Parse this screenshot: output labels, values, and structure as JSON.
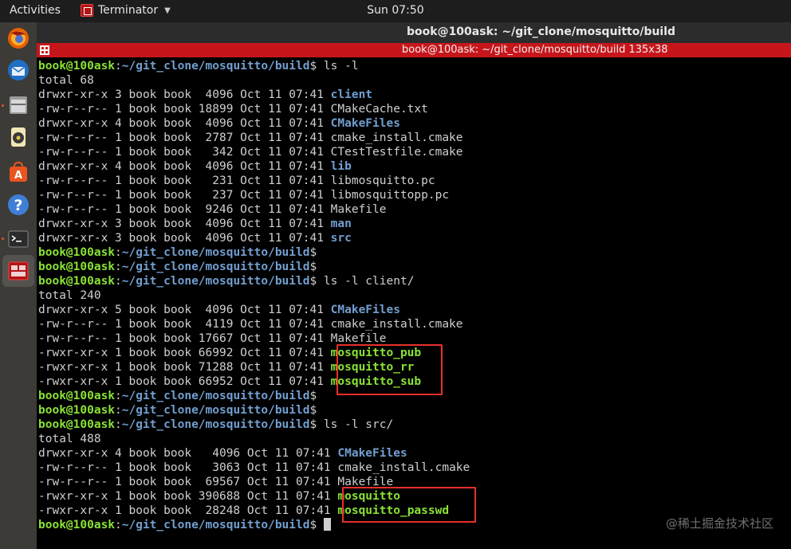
{
  "topbar": {
    "activities": "Activities",
    "app_name": "Terminator",
    "clock": "Sun 07:50"
  },
  "dock": {
    "items": [
      "firefox-icon",
      "thunderbird-icon",
      "files-icon",
      "rhythmbox-icon",
      "software-center-icon",
      "help-icon",
      "terminal-icon",
      "terminator-icon"
    ]
  },
  "window": {
    "title": "book@100ask: ~/git_clone/mosquitto/build",
    "tab_title": "book@100ask: ~/git_clone/mosquitto/build 135x38"
  },
  "terminal": {
    "prompt_user": "book@100ask",
    "prompt_path": "~/git_clone/mosquitto/build",
    "lines": [
      {
        "kind": "prompt",
        "cmd": " ls -l"
      },
      {
        "kind": "text",
        "text": "total 68"
      },
      {
        "kind": "entry",
        "perm": "drwxr-xr-x 3 book book  4096 Oct 11 07:41 ",
        "name": "client",
        "type": "dir"
      },
      {
        "kind": "entry",
        "perm": "-rw-r--r-- 1 book book 18899 Oct 11 07:41 ",
        "name": "CMakeCache.txt",
        "type": "file"
      },
      {
        "kind": "entry",
        "perm": "drwxr-xr-x 4 book book  4096 Oct 11 07:41 ",
        "name": "CMakeFiles",
        "type": "dir"
      },
      {
        "kind": "entry",
        "perm": "-rw-r--r-- 1 book book  2787 Oct 11 07:41 ",
        "name": "cmake_install.cmake",
        "type": "file"
      },
      {
        "kind": "entry",
        "perm": "-rw-r--r-- 1 book book   342 Oct 11 07:41 ",
        "name": "CTestTestfile.cmake",
        "type": "file"
      },
      {
        "kind": "entry",
        "perm": "drwxr-xr-x 4 book book  4096 Oct 11 07:41 ",
        "name": "lib",
        "type": "dir"
      },
      {
        "kind": "entry",
        "perm": "-rw-r--r-- 1 book book   231 Oct 11 07:41 ",
        "name": "libmosquitto.pc",
        "type": "file"
      },
      {
        "kind": "entry",
        "perm": "-rw-r--r-- 1 book book   237 Oct 11 07:41 ",
        "name": "libmosquittopp.pc",
        "type": "file"
      },
      {
        "kind": "entry",
        "perm": "-rw-r--r-- 1 book book  9246 Oct 11 07:41 ",
        "name": "Makefile",
        "type": "file"
      },
      {
        "kind": "entry",
        "perm": "drwxr-xr-x 3 book book  4096 Oct 11 07:41 ",
        "name": "man",
        "type": "dir"
      },
      {
        "kind": "entry",
        "perm": "drwxr-xr-x 3 book book  4096 Oct 11 07:41 ",
        "name": "src",
        "type": "dir"
      },
      {
        "kind": "prompt",
        "cmd": ""
      },
      {
        "kind": "prompt",
        "cmd": ""
      },
      {
        "kind": "prompt",
        "cmd": " ls -l client/"
      },
      {
        "kind": "text",
        "text": "total 240"
      },
      {
        "kind": "entry",
        "perm": "drwxr-xr-x 5 book book  4096 Oct 11 07:41 ",
        "name": "CMakeFiles",
        "type": "dir"
      },
      {
        "kind": "entry",
        "perm": "-rw-r--r-- 1 book book  4119 Oct 11 07:41 ",
        "name": "cmake_install.cmake",
        "type": "file"
      },
      {
        "kind": "entry",
        "perm": "-rw-r--r-- 1 book book 17667 Oct 11 07:41 ",
        "name": "Makefile",
        "type": "file"
      },
      {
        "kind": "entry",
        "perm": "-rwxr-xr-x 1 book book 66992 Oct 11 07:41 ",
        "name": "mosquitto_pub",
        "type": "exe"
      },
      {
        "kind": "entry",
        "perm": "-rwxr-xr-x 1 book book 71288 Oct 11 07:41 ",
        "name": "mosquitto_rr",
        "type": "exe"
      },
      {
        "kind": "entry",
        "perm": "-rwxr-xr-x 1 book book 66952 Oct 11 07:41 ",
        "name": "mosquitto_sub",
        "type": "exe"
      },
      {
        "kind": "prompt",
        "cmd": ""
      },
      {
        "kind": "prompt",
        "cmd": ""
      },
      {
        "kind": "prompt",
        "cmd": " ls -l src/"
      },
      {
        "kind": "text",
        "text": "total 488"
      },
      {
        "kind": "entry",
        "perm": "drwxr-xr-x 4 book book   4096 Oct 11 07:41 ",
        "name": "CMakeFiles",
        "type": "dir"
      },
      {
        "kind": "entry",
        "perm": "-rw-r--r-- 1 book book   3063 Oct 11 07:41 ",
        "name": "cmake_install.cmake",
        "type": "file"
      },
      {
        "kind": "entry",
        "perm": "-rw-r--r-- 1 book book  69567 Oct 11 07:41 ",
        "name": "Makefile",
        "type": "file"
      },
      {
        "kind": "entry",
        "perm": "-rwxr-xr-x 1 book book 390688 Oct 11 07:41 ",
        "name": "mosquitto",
        "type": "exe"
      },
      {
        "kind": "entry",
        "perm": "-rwxr-xr-x 1 book book  28248 Oct 11 07:41 ",
        "name": "mosquitto_passwd",
        "type": "exe"
      },
      {
        "kind": "prompt",
        "cmd": " ",
        "cursor": true
      }
    ]
  },
  "colors": {
    "prompt_green": "#8ae234",
    "dir_blue": "#729fcf",
    "tab_red": "#c7161b",
    "highlight_red": "#e8302a"
  },
  "watermark": "@稀土掘金技术社区"
}
